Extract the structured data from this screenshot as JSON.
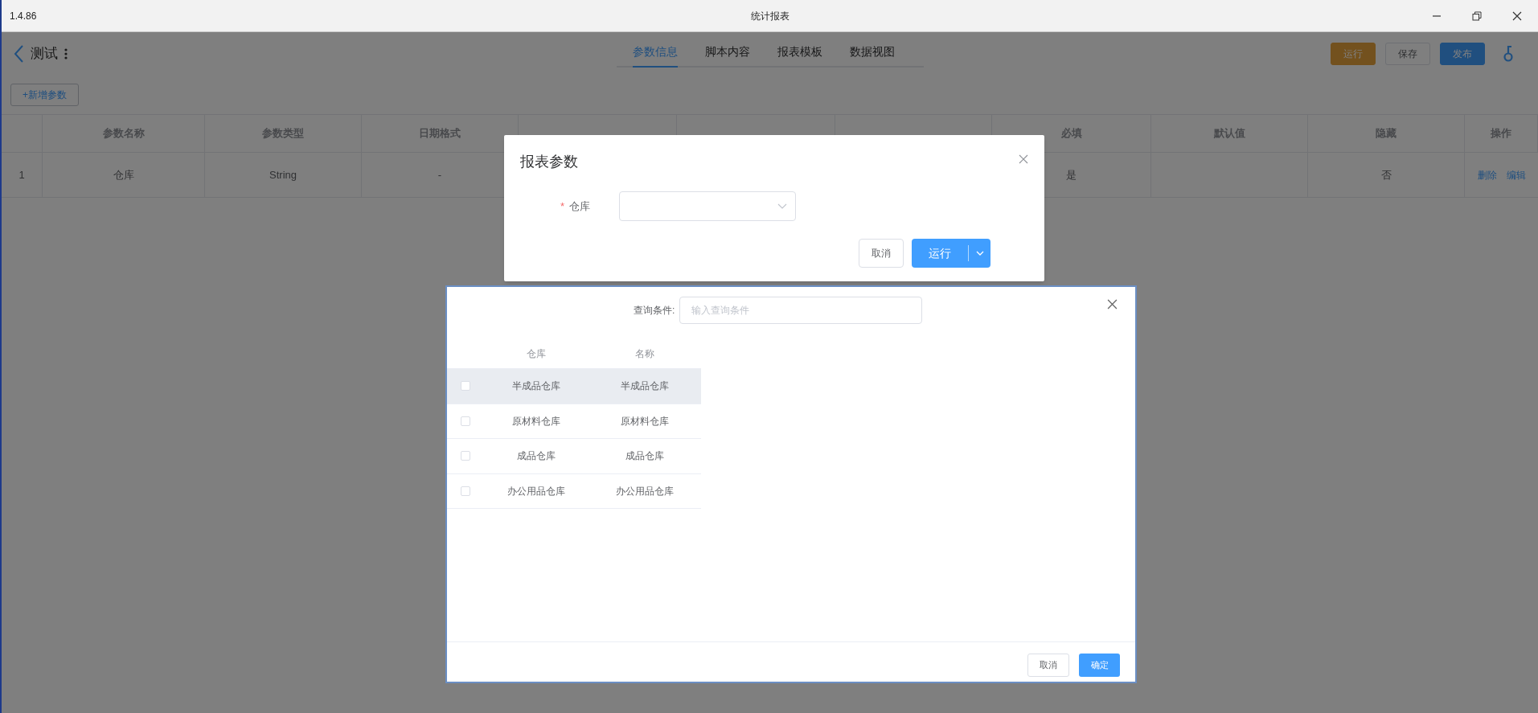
{
  "window": {
    "version": "1.4.86",
    "title": "统计报表"
  },
  "header": {
    "back_label": "测试",
    "tabs": [
      {
        "label": "参数信息",
        "selected": true
      },
      {
        "label": "脚本内容",
        "selected": false
      },
      {
        "label": "报表模板",
        "selected": false
      },
      {
        "label": "数据视图",
        "selected": false
      }
    ],
    "buttons": [
      {
        "label": "运行",
        "kind": "warning"
      },
      {
        "label": "保存",
        "kind": "default"
      },
      {
        "label": "发布",
        "kind": "primary"
      }
    ]
  },
  "add_button": "+新增参数",
  "table": {
    "columns": [
      "参数名称",
      "参数类型",
      "日期格式",
      null,
      null,
      null,
      "必填",
      "默认值",
      "隐藏",
      "操作"
    ],
    "rows": [
      {
        "index": "1",
        "cells": [
          "仓库",
          "String",
          "-",
          null,
          null,
          null,
          "是",
          null,
          "否"
        ],
        "actions": [
          "删除",
          "编辑"
        ]
      }
    ]
  },
  "report_dialog": {
    "title": "报表参数",
    "fields": [
      {
        "label": "仓库",
        "required_mark": "*"
      }
    ],
    "cancel": "取消",
    "run": "运行"
  },
  "picker_dialog": {
    "query_label": "查询条件:",
    "query_placeholder": "输入查询条件",
    "columns": [
      "仓库",
      "名称"
    ],
    "rows": [
      {
        "cells": [
          "半成品仓库",
          "半成品仓库"
        ],
        "checked": false,
        "hovered": true
      },
      {
        "cells": [
          "原材料仓库",
          "原材料仓库"
        ],
        "checked": false,
        "hovered": false
      },
      {
        "cells": [
          "成品仓库",
          "成品仓库"
        ],
        "checked": false,
        "hovered": false
      },
      {
        "cells": [
          "办公用品仓库",
          "办公用品仓库"
        ],
        "checked": false,
        "hovered": false
      }
    ],
    "cancel": "取消",
    "confirm": "确定"
  }
}
